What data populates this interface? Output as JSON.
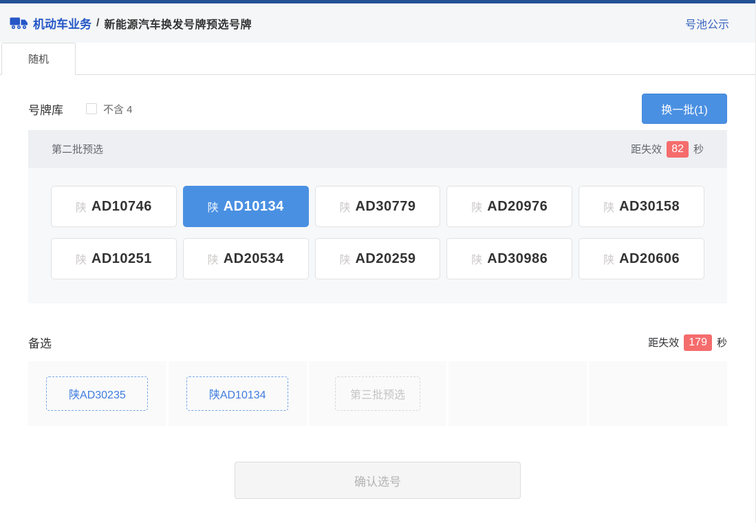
{
  "header": {
    "breadcrumb_root": "机动车业务",
    "separator": "/",
    "page_title": "新能源汽车换发号牌预选号牌",
    "pool_link": "号池公示"
  },
  "tabs": {
    "random": "随机"
  },
  "toolbar": {
    "library_label": "号牌库",
    "exclude_label": "不含 4",
    "exclude_checked": false,
    "refresh_button": "换一批(1)"
  },
  "batch": {
    "title": "第二批预选",
    "expire_prefix": "距失效",
    "expire_seconds": "82",
    "expire_suffix": "秒",
    "plates": [
      {
        "province": "陕",
        "number": "AD10746",
        "selected": false
      },
      {
        "province": "陕",
        "number": "AD10134",
        "selected": true
      },
      {
        "province": "陕",
        "number": "AD30779",
        "selected": false
      },
      {
        "province": "陕",
        "number": "AD20976",
        "selected": false
      },
      {
        "province": "陕",
        "number": "AD30158",
        "selected": false
      },
      {
        "province": "陕",
        "number": "AD10251",
        "selected": false
      },
      {
        "province": "陕",
        "number": "AD20534",
        "selected": false
      },
      {
        "province": "陕",
        "number": "AD20259",
        "selected": false
      },
      {
        "province": "陕",
        "number": "AD30986",
        "selected": false
      },
      {
        "province": "陕",
        "number": "AD20606",
        "selected": false
      }
    ]
  },
  "alternatives": {
    "title": "备选",
    "expire_prefix": "距失效",
    "expire_seconds": "179",
    "expire_suffix": "秒",
    "items": [
      {
        "label": "陕AD30235",
        "type": "reserved"
      },
      {
        "label": "陕AD10134",
        "type": "reserved"
      },
      {
        "label": "第三批预选",
        "type": "placeholder"
      }
    ]
  },
  "confirm_button": "确认选号",
  "colors": {
    "topbar": "#235294",
    "brand_blue": "#2557c7",
    "accent_blue": "#4a90e2",
    "badge_red": "#f56c6c"
  }
}
